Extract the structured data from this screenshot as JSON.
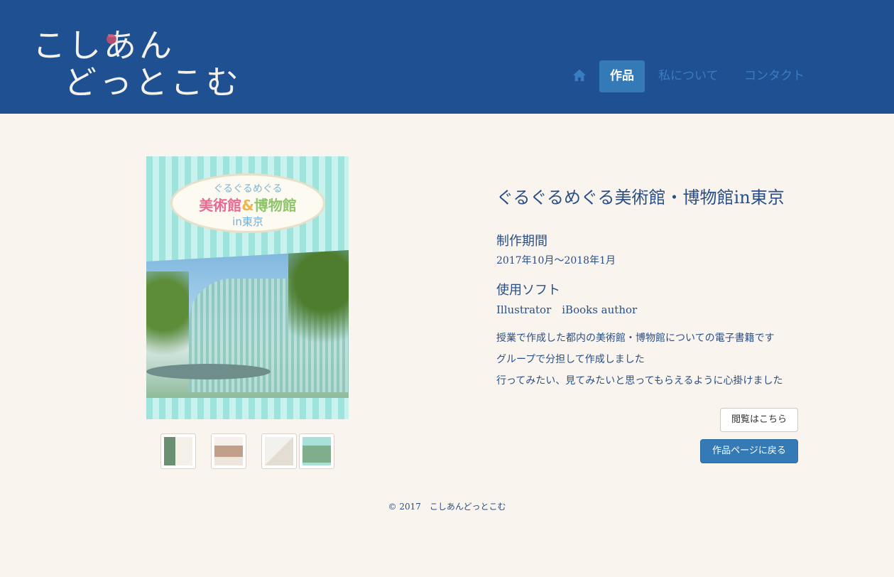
{
  "site": {
    "logo_line1": "こしあん",
    "logo_line2": "どっとこむ"
  },
  "nav": {
    "home_icon": "home-icon",
    "items": [
      {
        "label": "作品",
        "active": true
      },
      {
        "label": "私について",
        "active": false
      },
      {
        "label": "コンタクト",
        "active": false
      }
    ]
  },
  "cover": {
    "line1": "ぐるぐるめぐる",
    "line2a": "美術館",
    "line2b": "&",
    "line2c": "博物館",
    "line3": "in東京"
  },
  "work": {
    "title": "ぐるぐるめぐる美術館・博物館in東京",
    "period_label": "制作期間",
    "period_value": "2017年10月〜2018年1月",
    "software_label": "使用ソフト",
    "software_value": "Illustrator　iBooks author",
    "description": [
      "授業で作成した都内の美術館・博物館についての電子書籍です",
      "グループで分担して作成しました",
      "行ってみたい、見てみたいと思ってもらえるように心掛けました"
    ]
  },
  "buttons": {
    "view": "閲覧はこちら",
    "back": "作品ページに戻る"
  },
  "footer": {
    "copyright": "© 2017　こしあんどっとこむ"
  },
  "colors": {
    "header_bg": "#1f5192",
    "page_bg": "#f9f4ee",
    "accent": "#337ab7",
    "text": "#2a4f86"
  }
}
